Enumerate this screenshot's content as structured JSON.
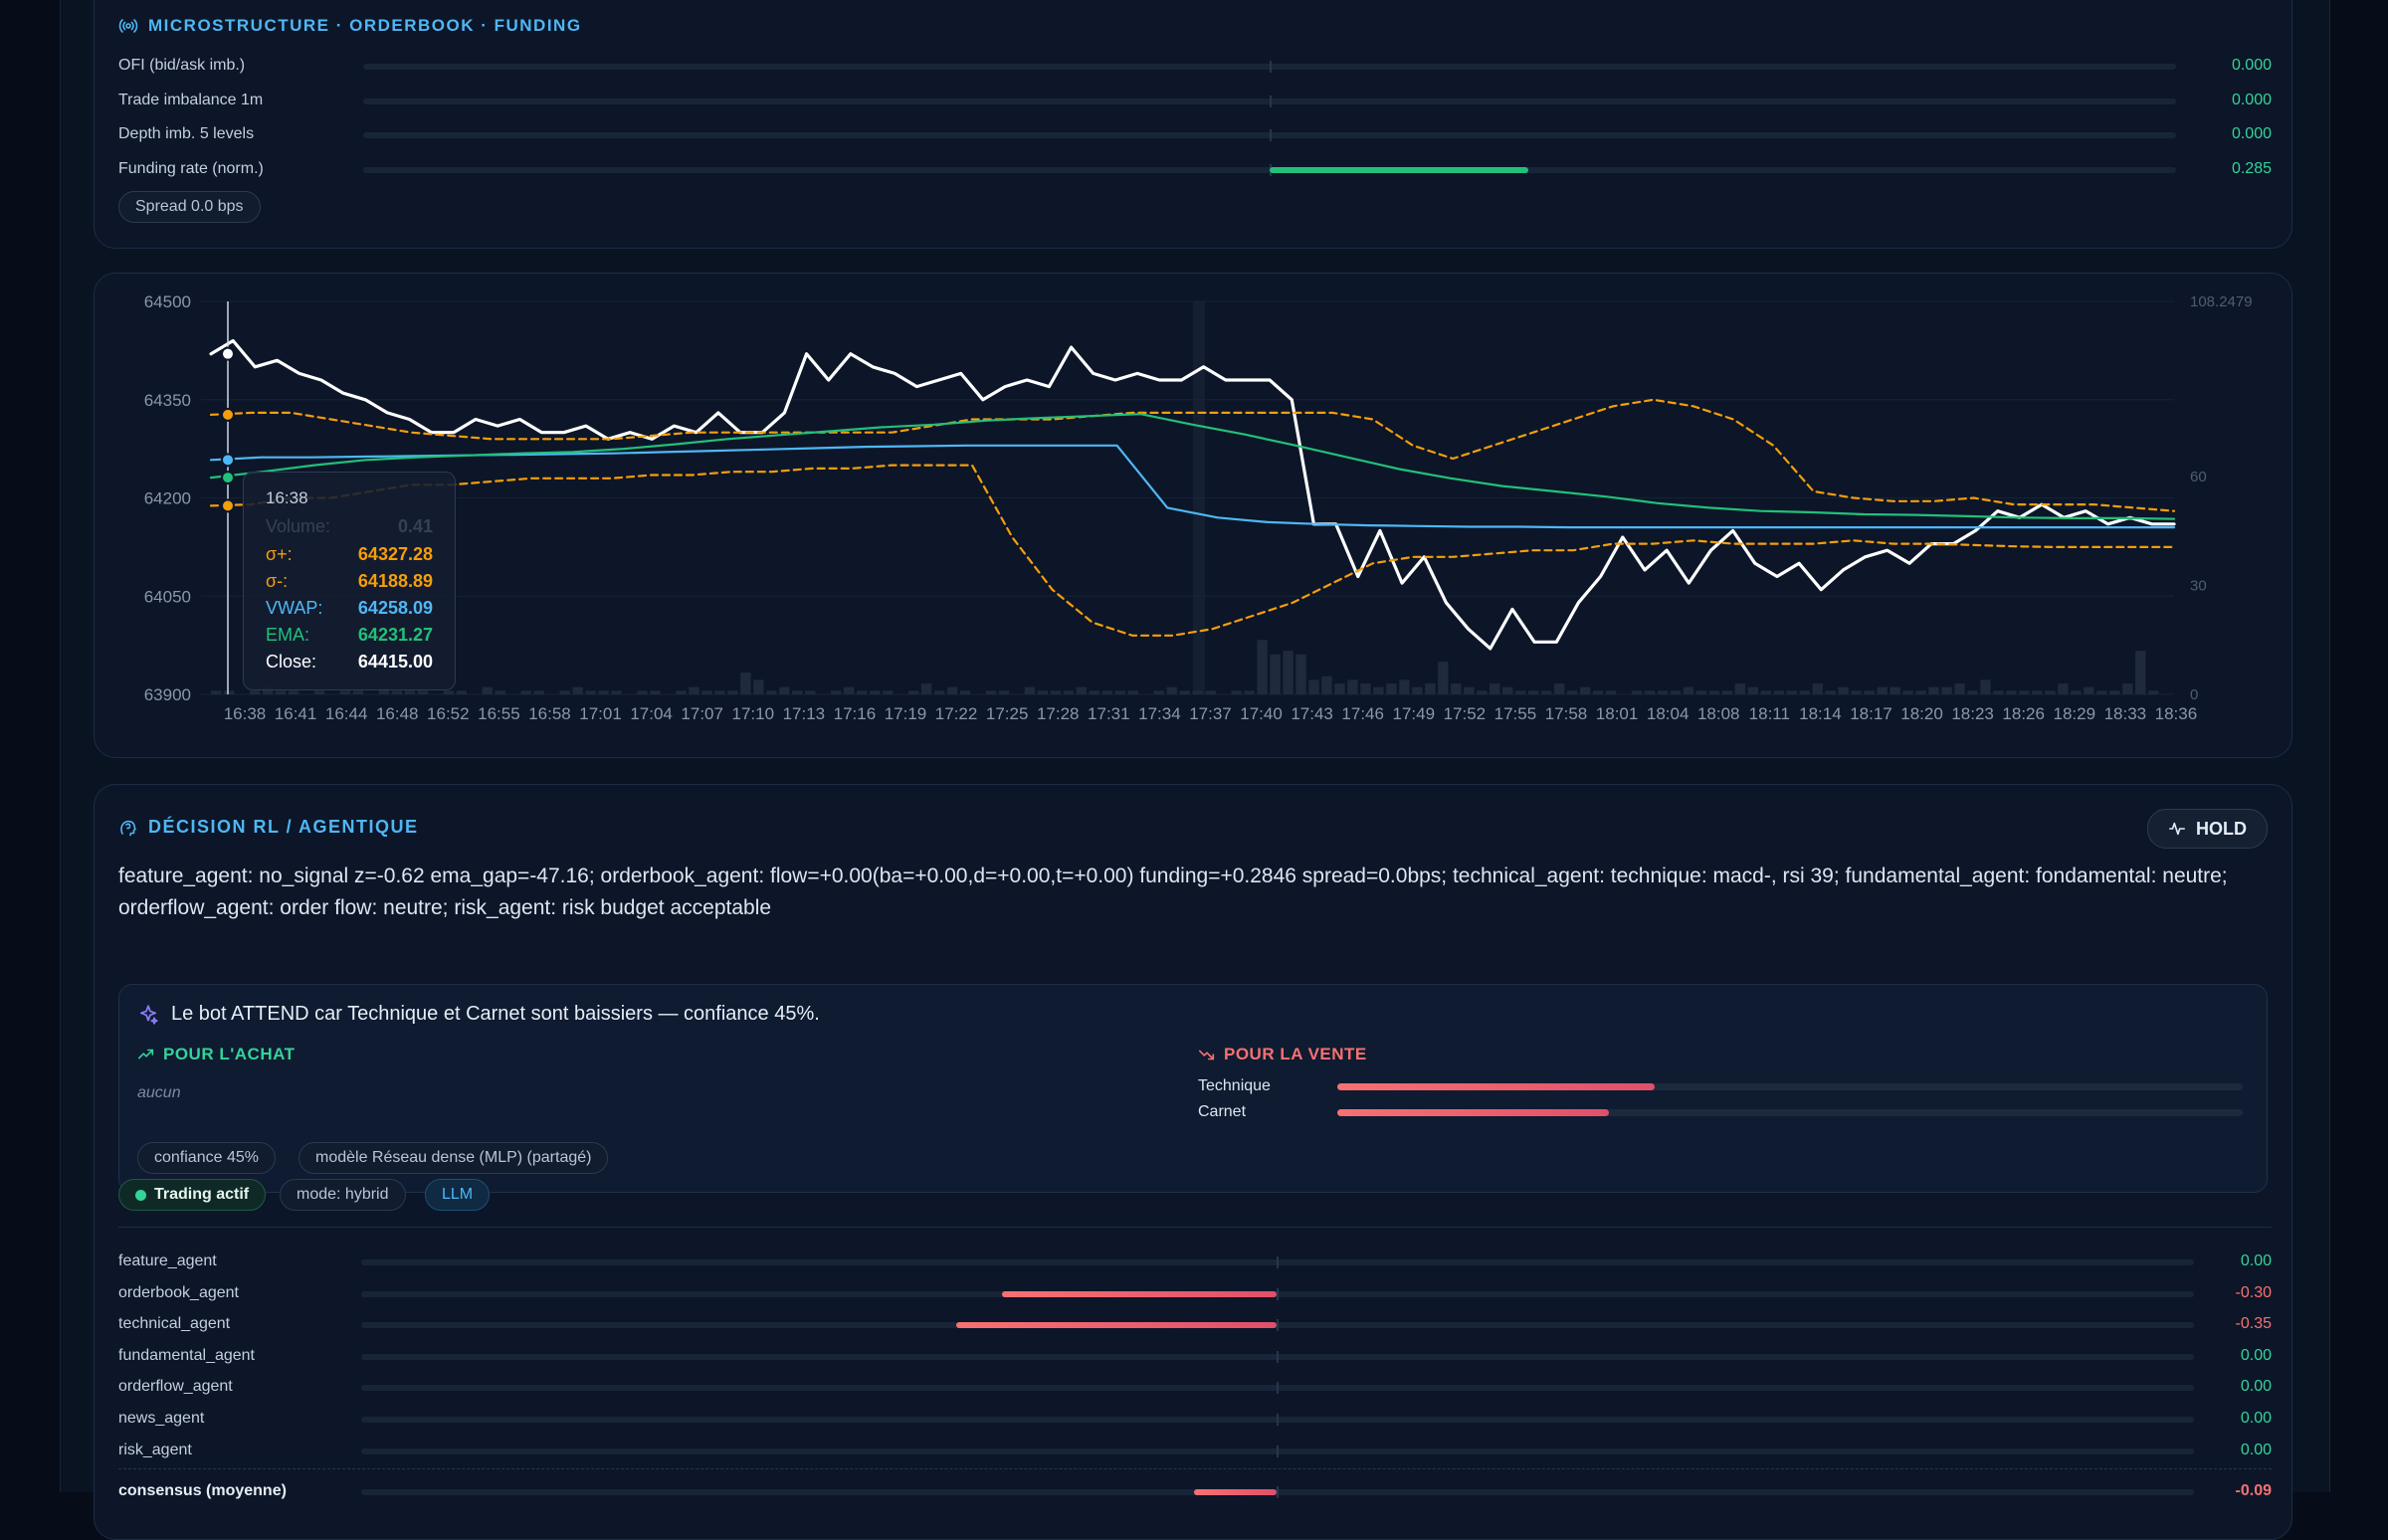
{
  "microstructure": {
    "title": "MICROSTRUCTURE · ORDERBOOK · FUNDING",
    "icon": "radio-signal-icon",
    "rows": [
      {
        "label": "OFI (bid/ask imb.)",
        "value": "0.000",
        "fraction": 0.0
      },
      {
        "label": "Trade imbalance 1m",
        "value": "0.000",
        "fraction": 0.0
      },
      {
        "label": "Depth imb. 5 levels",
        "value": "0.000",
        "fraction": 0.0
      },
      {
        "label": "Funding rate (norm.)",
        "value": "0.285",
        "fraction": 0.285
      }
    ],
    "spread_pill": "Spread 0.0 bps",
    "positive_color": "#34d399"
  },
  "chart_data": {
    "type": "line",
    "y_ticks": [
      "64500",
      "64350",
      "64200",
      "64050",
      "63900"
    ],
    "ylim": [
      63900,
      64500
    ],
    "volume_ticks": [
      "108.2479",
      "60",
      "30",
      "0"
    ],
    "volume_lim": [
      0,
      108.2479
    ],
    "x_ticks": [
      "16:38",
      "16:41",
      "16:44",
      "16:48",
      "16:52",
      "16:55",
      "16:58",
      "17:01",
      "17:04",
      "17:07",
      "17:10",
      "17:13",
      "17:16",
      "17:19",
      "17:22",
      "17:25",
      "17:28",
      "17:31",
      "17:34",
      "17:37",
      "17:40",
      "17:43",
      "17:46",
      "17:49",
      "17:52",
      "17:55",
      "17:58",
      "18:01",
      "18:04",
      "18:08",
      "18:11",
      "18:14",
      "18:17",
      "18:20",
      "18:23",
      "18:26",
      "18:29",
      "18:33",
      "18:36"
    ],
    "series": [
      {
        "name": "Close",
        "color": "#ffffff",
        "values": [
          64420,
          64440,
          64400,
          64410,
          64390,
          64380,
          64360,
          64350,
          64330,
          64320,
          64300,
          64300,
          64320,
          64310,
          64320,
          64300,
          64300,
          64310,
          64290,
          64300,
          64290,
          64310,
          64300,
          64330,
          64300,
          64300,
          64330,
          64420,
          64380,
          64420,
          64400,
          64390,
          64370,
          64380,
          64390,
          64350,
          64370,
          64380,
          64370,
          64430,
          64390,
          64380,
          64390,
          64380,
          64380,
          64400,
          64380,
          64380,
          64380,
          64350,
          64160,
          64160,
          64080,
          64150,
          64070,
          64110,
          64040,
          64000,
          63970,
          64030,
          63980,
          63980,
          64040,
          64080,
          64140,
          64090,
          64120,
          64070,
          64120,
          64150,
          64100,
          64080,
          64100,
          64060,
          64090,
          64110,
          64120,
          64100,
          64130,
          64130,
          64150,
          64180,
          64170,
          64190,
          64170,
          64180,
          64160,
          64170,
          64160,
          64160
        ]
      },
      {
        "name": "σ+",
        "color": "#f59e0b",
        "dashed": true,
        "values": [
          64327,
          64330,
          64330,
          64320,
          64310,
          64300,
          64295,
          64290,
          64290,
          64290,
          64290,
          64295,
          64300,
          64300,
          64300,
          64300,
          64300,
          64300,
          64310,
          64320,
          64320,
          64320,
          64325,
          64330,
          64330,
          64330,
          64330,
          64330,
          64330,
          64320,
          64280,
          64260,
          64280,
          64300,
          64320,
          64340,
          64350,
          64340,
          64320,
          64280,
          64210,
          64200,
          64195,
          64195,
          64200,
          64190,
          64190,
          64190,
          64185,
          64180
        ]
      },
      {
        "name": "σ-",
        "color": "#f59e0b",
        "dashed": true,
        "values": [
          64188,
          64190,
          64200,
          64200,
          64210,
          64220,
          64220,
          64225,
          64230,
          64230,
          64230,
          64235,
          64235,
          64240,
          64240,
          64245,
          64245,
          64250,
          64250,
          64250,
          64140,
          64060,
          64010,
          63990,
          63990,
          64000,
          64020,
          64040,
          64070,
          64100,
          64110,
          64110,
          64115,
          64120,
          64120,
          64130,
          64130,
          64135,
          64130,
          64130,
          64130,
          64135,
          64130,
          64130,
          64128,
          64126,
          64125,
          64125,
          64125,
          64125
        ]
      },
      {
        "name": "VWAP",
        "color": "#4fb7f5",
        "values": [
          64258,
          64262,
          64262,
          64263,
          64264,
          64265,
          64266,
          64267,
          64268,
          64270,
          64272,
          64274,
          64276,
          64278,
          64279,
          64280,
          64280,
          64280,
          64280,
          64185,
          64170,
          64163,
          64160,
          64158,
          64157,
          64156,
          64156,
          64155,
          64155,
          64155,
          64155,
          64155,
          64155,
          64155,
          64155,
          64155,
          64155,
          64155,
          64155,
          64155
        ]
      },
      {
        "name": "EMA",
        "color": "#22c07a",
        "values": [
          64231,
          64240,
          64250,
          64258,
          64262,
          64265,
          64268,
          64270,
          64275,
          64282,
          64290,
          64296,
          64302,
          64308,
          64312,
          64318,
          64322,
          64325,
          64328,
          64312,
          64297,
          64280,
          64262,
          64244,
          64230,
          64218,
          64210,
          64202,
          64192,
          64185,
          64180,
          64178,
          64175,
          64174,
          64172,
          64170,
          64169,
          64169,
          64168
        ]
      }
    ],
    "volume": [
      1,
      1,
      0,
      1,
      2,
      1,
      1,
      0,
      1,
      0,
      1,
      1,
      0,
      2,
      1,
      1,
      1,
      0,
      1,
      1,
      0,
      2,
      1,
      0,
      1,
      1,
      0,
      1,
      2,
      1,
      1,
      1,
      0,
      1,
      1,
      0,
      1,
      2,
      1,
      1,
      1,
      6,
      4,
      1,
      2,
      1,
      1,
      0,
      1,
      2,
      1,
      1,
      1,
      0,
      1,
      3,
      1,
      2,
      1,
      0,
      1,
      1,
      0,
      2,
      1,
      1,
      1,
      2,
      1,
      1,
      1,
      1,
      0,
      1,
      2,
      1,
      1,
      1,
      0,
      1,
      1,
      15,
      11,
      12,
      11,
      4,
      5,
      3,
      4,
      3,
      2,
      3,
      4,
      2,
      3,
      9,
      3,
      2,
      1,
      3,
      2,
      1,
      1,
      1,
      3,
      1,
      2,
      1,
      1,
      0,
      1,
      1,
      1,
      1,
      2,
      1,
      1,
      1,
      3,
      2,
      1,
      1,
      1,
      1,
      3,
      1,
      2,
      1,
      1,
      2,
      2,
      1,
      1,
      2,
      2,
      3,
      1,
      4,
      1,
      1,
      1,
      1,
      1,
      3,
      1,
      2,
      1,
      1,
      3,
      12,
      1,
      0
    ],
    "tooltip": {
      "time": "16:38",
      "volume_label": "Volume:",
      "volume_value": "0.41",
      "rows": [
        {
          "label": "σ+:",
          "value": "64327.28",
          "color": "#f59e0b"
        },
        {
          "label": "σ-:",
          "value": "64188.89",
          "color": "#f59e0b"
        },
        {
          "label": "VWAP:",
          "value": "64258.09",
          "color": "#4fb7f5"
        },
        {
          "label": "EMA:",
          "value": "64231.27",
          "color": "#22c07a"
        },
        {
          "label": "Close:",
          "value": "64415.00",
          "color": "#ffffff"
        }
      ]
    },
    "grid": true
  },
  "decision": {
    "title": "DÉCISION RL / AGENTIQUE",
    "icon": "brain-icon",
    "action": "HOLD",
    "summary": "feature_agent: no_signal z=-0.62 ema_gap=-47.16; orderbook_agent: flow=+0.00(ba=+0.00,d=+0.00,t=+0.00) funding=+0.2846 spread=0.0bps; technical_agent: technique: macd-, rsi 39; fundamental_agent: fondamental: neutre; orderflow_agent: order flow: neutre; risk_agent: risk budget acceptable",
    "explanation": {
      "headline": "Le bot ATTEND car Technique et Carnet sont baissiers — confiance 45%.",
      "buy_title": "POUR L'ACHAT",
      "buy_empty": "aucun",
      "sell_title": "POUR LA VENTE",
      "sell_items": [
        {
          "label": "Technique",
          "fraction": 0.35
        },
        {
          "label": "Carnet",
          "fraction": 0.3
        }
      ],
      "tags": [
        "confiance 45%",
        "modèle Réseau dense (MLP) (partagé)"
      ]
    },
    "status_pills": {
      "active": "Trading actif",
      "mode": "mode: hybrid",
      "llm": "LLM"
    },
    "agents": [
      {
        "name": "feature_agent",
        "value": "0.00",
        "score": 0.0
      },
      {
        "name": "orderbook_agent",
        "value": "-0.30",
        "score": -0.3
      },
      {
        "name": "technical_agent",
        "value": "-0.35",
        "score": -0.35
      },
      {
        "name": "fundamental_agent",
        "value": "0.00",
        "score": 0.0
      },
      {
        "name": "orderflow_agent",
        "value": "0.00",
        "score": 0.0
      },
      {
        "name": "news_agent",
        "value": "0.00",
        "score": 0.0
      },
      {
        "name": "risk_agent",
        "value": "0.00",
        "score": 0.0
      }
    ],
    "consensus": {
      "label": "consensus (moyenne)",
      "value": "-0.09",
      "score": -0.09
    },
    "negative_color": "#f87171",
    "positive_color": "#34d399"
  }
}
